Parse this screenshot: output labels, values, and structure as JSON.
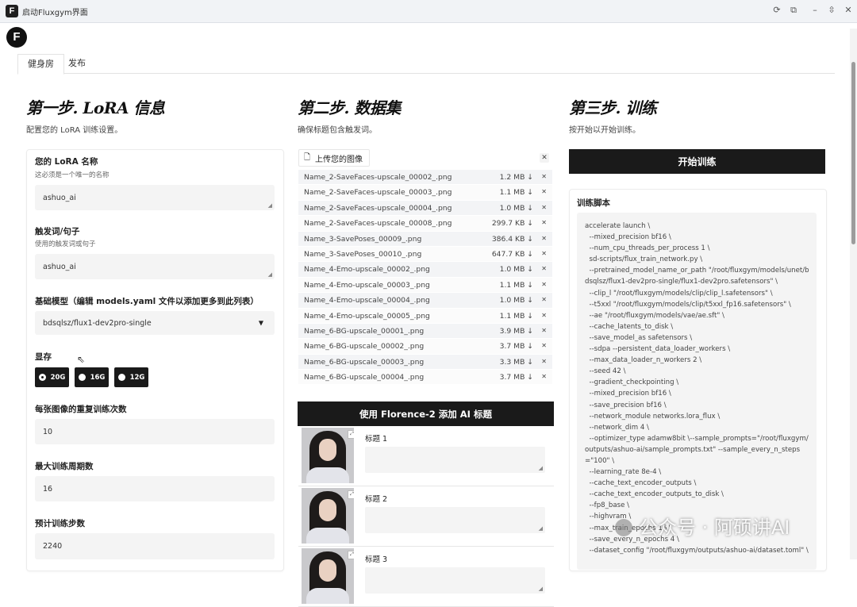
{
  "window": {
    "title": "启动Fluxgym界面",
    "app_icon_letter": "F"
  },
  "logo_letter": "F",
  "tabs": [
    "健身房",
    "发布"
  ],
  "step1": {
    "title": "第一步. LoRA 信息",
    "subtitle": "配置您的 LoRA 训练设置。",
    "lora_name_label": "您的 LoRA 名称",
    "lora_name_hint": "这必须是一个唯一的名称",
    "lora_name_value": "ashuo_ai",
    "trigger_label": "触发词/句子",
    "trigger_hint": "使用的触发词或句子",
    "trigger_value": "ashuo_ai",
    "base_model_label": "基础模型（编辑 models.yaml 文件以添加更多到此列表）",
    "base_model_value": "bdsqlsz/flux1-dev2pro-single",
    "vram_label": "显存",
    "vram_options": [
      "20G",
      "16G",
      "12G"
    ],
    "vram_selected": "20G",
    "repeats_label": "每张图像的重复训练次数",
    "repeats_value": "10",
    "epochs_label": "最大训练周期数",
    "epochs_value": "16",
    "steps_label": "预计训练步数",
    "steps_value": "2240"
  },
  "step2": {
    "title": "第二步. 数据集",
    "subtitle": "确保标题包含触发词。",
    "upload_label": "上传您的图像",
    "files": [
      {
        "name": "Name_2-SaveFaces-upscale_00002_.png",
        "size": "1.2 MB ↓"
      },
      {
        "name": "Name_2-SaveFaces-upscale_00003_.png",
        "size": "1.1 MB ↓"
      },
      {
        "name": "Name_2-SaveFaces-upscale_00004_.png",
        "size": "1.0 MB ↓"
      },
      {
        "name": "Name_2-SaveFaces-upscale_00008_.png",
        "size": "299.7 KB ↓"
      },
      {
        "name": "Name_3-SavePoses_00009_.png",
        "size": "386.4 KB ↓"
      },
      {
        "name": "Name_3-SavePoses_00010_.png",
        "size": "647.7 KB ↓"
      },
      {
        "name": "Name_4-Emo-upscale_00002_.png",
        "size": "1.0 MB ↓"
      },
      {
        "name": "Name_4-Emo-upscale_00003_.png",
        "size": "1.1 MB ↓"
      },
      {
        "name": "Name_4-Emo-upscale_00004_.png",
        "size": "1.0 MB ↓"
      },
      {
        "name": "Name_4-Emo-upscale_00005_.png",
        "size": "1.1 MB ↓"
      },
      {
        "name": "Name_6-BG-upscale_00001_.png",
        "size": "3.9 MB ↓"
      },
      {
        "name": "Name_6-BG-upscale_00002_.png",
        "size": "3.7 MB ↓"
      },
      {
        "name": "Name_6-BG-upscale_00003_.png",
        "size": "3.3 MB ↓"
      },
      {
        "name": "Name_6-BG-upscale_00004_.png",
        "size": "3.7 MB ↓"
      }
    ],
    "florence_button": "使用 Florence-2 添加 AI 标题",
    "captions": [
      {
        "label": "标题 1",
        "value": ""
      },
      {
        "label": "标题 2",
        "value": ""
      },
      {
        "label": "标题 3",
        "value": ""
      }
    ]
  },
  "step3": {
    "title": "第三步. 训练",
    "subtitle": "按开始以开始训练。",
    "start_button": "开始训练",
    "script_label": "训练脚本",
    "script": "accelerate launch \\\n  --mixed_precision bf16 \\\n  --num_cpu_threads_per_process 1 \\\n  sd-scripts/flux_train_network.py \\\n  --pretrained_model_name_or_path \"/root/fluxgym/models/unet/bdsqlsz/flux1-dev2pro-single/flux1-dev2pro.safetensors\" \\\n  --clip_l \"/root/fluxgym/models/clip/clip_l.safetensors\" \\\n  --t5xxl \"/root/fluxgym/models/clip/t5xxl_fp16.safetensors\" \\\n  --ae \"/root/fluxgym/models/vae/ae.sft\" \\\n  --cache_latents_to_disk \\\n  --save_model_as safetensors \\\n  --sdpa --persistent_data_loader_workers \\\n  --max_data_loader_n_workers 2 \\\n  --seed 42 \\\n  --gradient_checkpointing \\\n  --mixed_precision bf16 \\\n  --save_precision bf16 \\\n  --network_module networks.lora_flux \\\n  --network_dim 4 \\\n  --optimizer_type adamw8bit \\--sample_prompts=\"/root/fluxgym/outputs/ashuo-ai/sample_prompts.txt\" --sample_every_n_steps=\"100\" \\\n  --learning_rate 8e-4 \\\n  --cache_text_encoder_outputs \\\n  --cache_text_encoder_outputs_to_disk \\\n  --fp8_base \\\n  --highvram \\\n  --max_train_epochs 16 \\\n  --save_every_n_epochs 4 \\\n  --dataset_config \"/root/fluxgym/outputs/ashuo-ai/dataset.toml\" \\"
  },
  "watermark": "公众号 · 阿硕讲AI",
  "icons": {
    "window_controls": [
      "reload-icon",
      "external-link-icon",
      "minimize-icon",
      "resize-icon",
      "close-icon"
    ],
    "upload": "file-icon",
    "dropdown": "chevron-down-icon"
  }
}
